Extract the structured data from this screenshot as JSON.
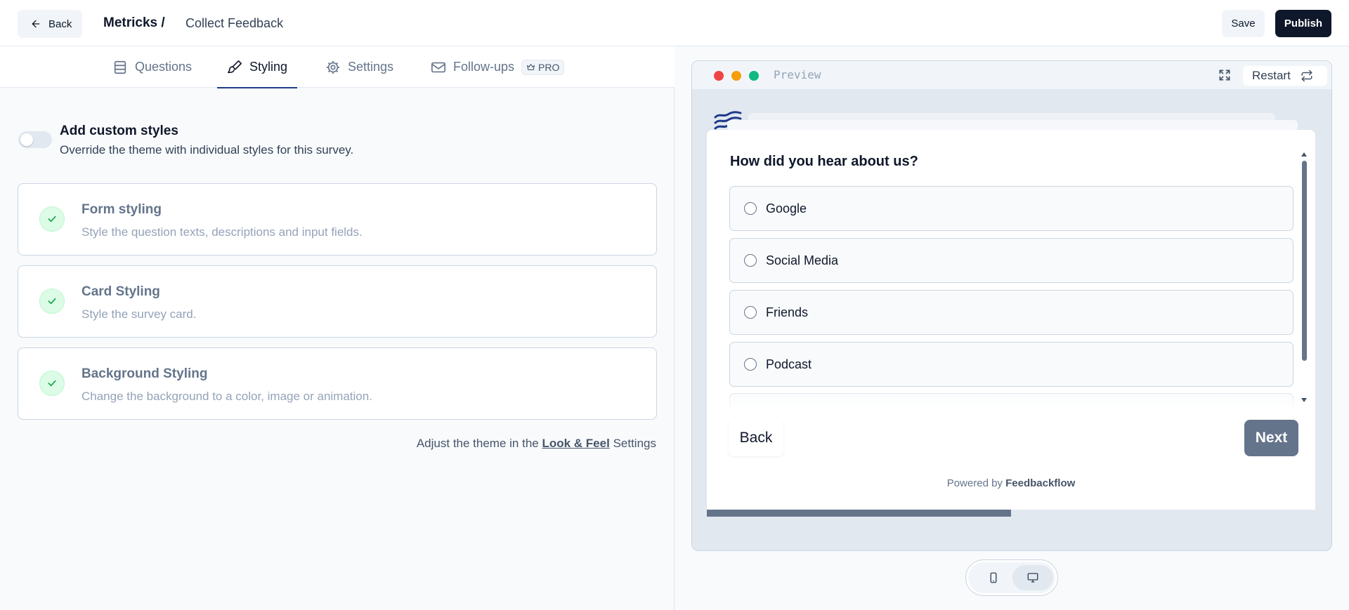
{
  "header": {
    "back_label": "Back",
    "project": "Metricks /",
    "survey_name": "Collect Feedback",
    "save_label": "Save",
    "publish_label": "Publish"
  },
  "tabs": [
    {
      "label": "Questions",
      "icon": "list-icon"
    },
    {
      "label": "Styling",
      "icon": "paintbrush-icon",
      "active": true
    },
    {
      "label": "Settings",
      "icon": "gear-icon"
    },
    {
      "label": "Follow-ups",
      "icon": "mail-icon",
      "badge": "PRO"
    }
  ],
  "custom_styles": {
    "title": "Add custom styles",
    "description": "Override the theme with individual styles for this survey.",
    "enabled": false
  },
  "cards": [
    {
      "title": "Form styling",
      "description": "Style the question texts, descriptions and input fields."
    },
    {
      "title": "Card Styling",
      "description": "Style the survey card."
    },
    {
      "title": "Background Styling",
      "description": "Change the background to a color, image or animation."
    }
  ],
  "adjust_note": {
    "prefix": "Adjust the theme in the",
    "link": "Look & Feel",
    "suffix": "Settings"
  },
  "preview": {
    "label": "Preview",
    "restart_label": "Restart",
    "question": "How did you hear about us?",
    "options": [
      "Google",
      "Social Media",
      "Friends",
      "Podcast"
    ],
    "back_label": "Back",
    "next_label": "Next",
    "powered_prefix": "Powered by",
    "powered_brand": "Feedbackflow",
    "progress": 0.5
  },
  "colors": {
    "accent": "#1e3a8a",
    "primary_dark": "#0f172a",
    "next_button": "#64748b",
    "check_bg": "#dcfce7",
    "check_icon": "#16a34a",
    "dot_red": "#ef4444",
    "dot_yellow": "#f59e0b",
    "dot_green": "#10b981"
  },
  "device_toggle": {
    "options": [
      "mobile-icon",
      "desktop-icon"
    ],
    "active": "desktop-icon"
  }
}
